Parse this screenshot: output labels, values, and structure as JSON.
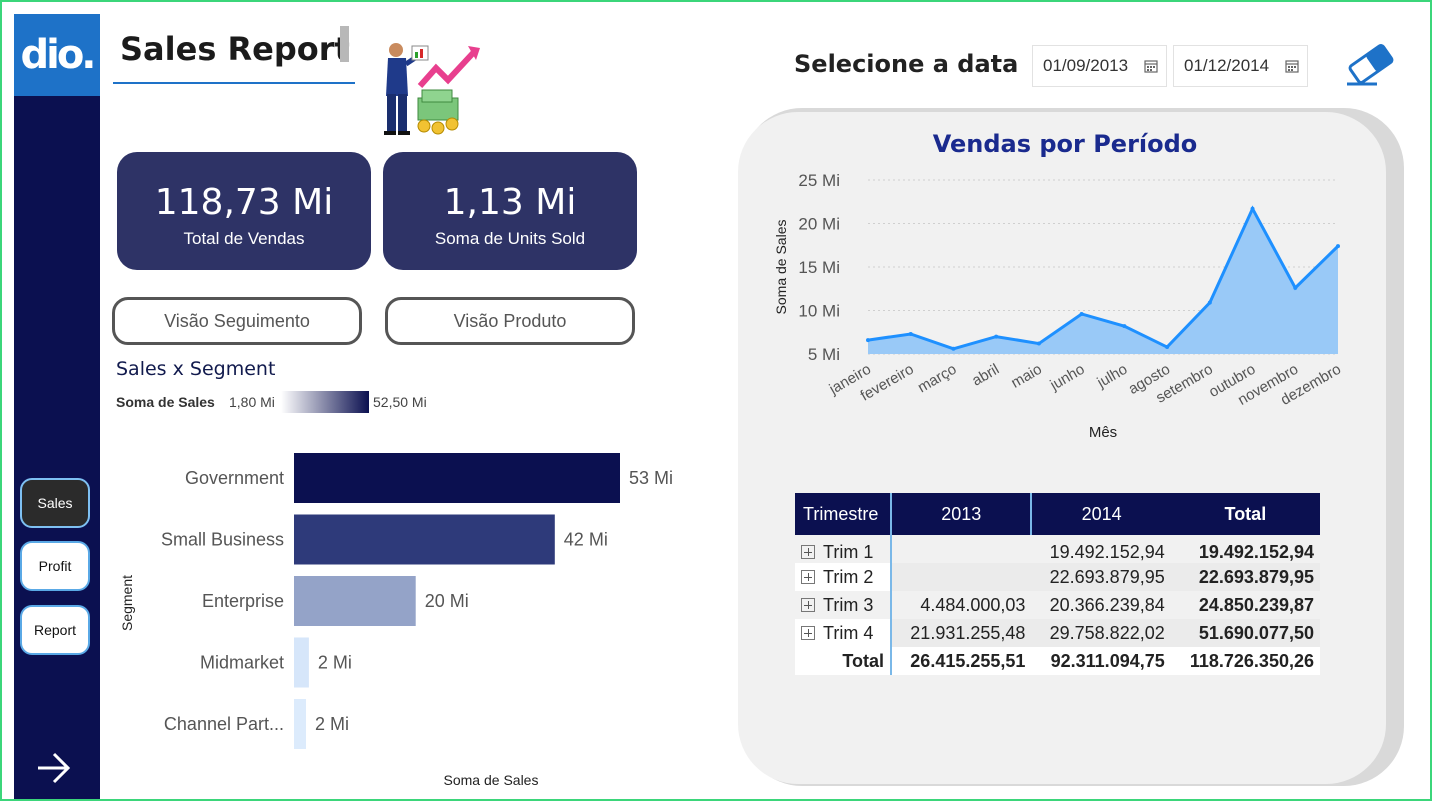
{
  "header": {
    "title": "Sales Report",
    "date_label": "Selecione a data",
    "date_start": "01/09/2013",
    "date_end": "01/12/2014"
  },
  "sidebar": {
    "logo": "dio.",
    "items": [
      {
        "label": "Sales",
        "active": true
      },
      {
        "label": "Profit",
        "active": false
      },
      {
        "label": "Report",
        "active": false
      }
    ]
  },
  "kpis": [
    {
      "value": "118,73 Mi",
      "label": "Total de Vendas"
    },
    {
      "value": "1,13 Mi",
      "label": "Soma de Units Sold"
    }
  ],
  "view_buttons": [
    "Visão Seguimento",
    "Visão Produto"
  ],
  "colors": {
    "sidebar": "#0b1050",
    "logo_bg": "#1e72c8",
    "card_bg": "#2e3366",
    "line_stroke": "#1e90ff",
    "line_fill": "#99c9f7",
    "title_blue": "#1a2a8e"
  },
  "icons": [
    "calendar-icon",
    "eraser-icon",
    "arrow-right-icon",
    "expand-icon"
  ],
  "segment_chart": {
    "title": "Sales x Segment",
    "legend_title": "Soma de  Sales",
    "legend_min": "1,80 Mi",
    "legend_max": "52,50 Mi",
    "xlabel": "Soma de Sales",
    "ylabel": "Segment"
  },
  "line_chart": {
    "title": "Vendas por Período",
    "xlabel": "Mês",
    "ylabel": "Soma de Sales"
  },
  "chart_data": [
    {
      "type": "bar",
      "orientation": "horizontal",
      "title": "Sales x Segment",
      "xlabel": "Soma de Sales",
      "ylabel": "Segment",
      "categories": [
        "Government",
        "Small Business",
        "Enterprise",
        "Midmarket",
        "Channel Part..."
      ],
      "values": [
        52.5,
        42,
        19.6,
        2.4,
        1.8
      ],
      "data_labels": [
        "53 Mi",
        "42 Mi",
        "20 Mi",
        "2 Mi",
        "2 Mi"
      ],
      "colors": [
        "#0b1050",
        "#2e3a7a",
        "#94a3c8",
        "#d6e6fa",
        "#dcebfc"
      ],
      "color_scale": {
        "min": "1,80 Mi",
        "max": "52,50 Mi"
      }
    },
    {
      "type": "area",
      "title": "Vendas por Período",
      "xlabel": "Mês",
      "ylabel": "Soma de Sales",
      "categories": [
        "janeiro",
        "fevereiro",
        "março",
        "abril",
        "maio",
        "junho",
        "julho",
        "agosto",
        "setembro",
        "outubro",
        "novembro",
        "dezembro"
      ],
      "values": [
        6.6,
        7.3,
        5.6,
        7.0,
        6.2,
        9.6,
        8.2,
        5.8,
        10.9,
        21.7,
        12.6,
        17.4
      ],
      "unit": "Mi",
      "y_ticks": [
        "5 Mi",
        "10 Mi",
        "15 Mi",
        "20 Mi",
        "25 Mi"
      ],
      "ylim": [
        5,
        25
      ],
      "grid": true
    }
  ],
  "matrix": {
    "headers": [
      "Trimestre",
      "2013",
      "2014",
      "Total"
    ],
    "rows": [
      {
        "label": "Trim 1",
        "y2013": "",
        "y2014": "19.492.152,94",
        "total": "19.492.152,94"
      },
      {
        "label": "Trim 2",
        "y2013": "",
        "y2014": "22.693.879,95",
        "total": "22.693.879,95"
      },
      {
        "label": "Trim 3",
        "y2013": "4.484.000,03",
        "y2014": "20.366.239,84",
        "total": "24.850.239,87"
      },
      {
        "label": "Trim 4",
        "y2013": "21.931.255,48",
        "y2014": "29.758.822,02",
        "total": "51.690.077,50"
      }
    ],
    "total_row": {
      "label": "Total",
      "y2013": "26.415.255,51",
      "y2014": "92.311.094,75",
      "total": "118.726.350,26"
    }
  }
}
